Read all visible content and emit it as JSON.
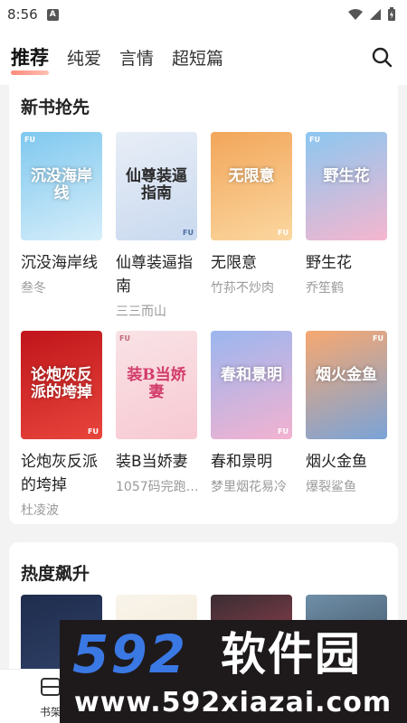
{
  "status_bar": {
    "time": "8:56",
    "notification_badge": "A"
  },
  "nav": {
    "tabs": [
      {
        "label": "推荐",
        "active": true
      },
      {
        "label": "纯爱",
        "active": false
      },
      {
        "label": "言情",
        "active": false
      },
      {
        "label": "超短篇",
        "active": false
      }
    ]
  },
  "sections": {
    "new_books": {
      "title": "新书抢先",
      "books": [
        {
          "title": "沉没海岸线",
          "author": "叁冬",
          "cover_text": "沉没海岸线",
          "cover_colors": [
            "#7fc8ef",
            "#d6eefa"
          ]
        },
        {
          "title": "仙尊装逼指南",
          "author": "三三而山",
          "cover_text": "仙尊装逼指南",
          "cover_colors": [
            "#e8eef7",
            "#c9d9ef"
          ]
        },
        {
          "title": "无限意",
          "author": "竹荪不炒肉",
          "cover_text": "无限意",
          "cover_colors": [
            "#f2a65a",
            "#fbd7a0"
          ]
        },
        {
          "title": "野生花",
          "author": "乔笙鹤",
          "cover_text": "野生花",
          "cover_colors": [
            "#8cc7f0",
            "#f5b6cf"
          ]
        },
        {
          "title": "论炮灰反派的垮掉",
          "author": "杜凌波",
          "cover_text": "论炮灰反派的垮掉",
          "cover_colors": [
            "#c0151b",
            "#e8453c"
          ]
        },
        {
          "title": "装B当娇妻",
          "author": "1057码完跑…",
          "cover_text": "装B当娇妻",
          "cover_colors": [
            "#f9e3e6",
            "#f7c9d2"
          ]
        },
        {
          "title": "春和景明",
          "author": "梦里烟花易冷",
          "cover_text": "春和景明",
          "cover_colors": [
            "#9bb6ef",
            "#f3b2d0"
          ]
        },
        {
          "title": "烟火金鱼",
          "author": "爆裂鲨鱼",
          "cover_text": "烟火金鱼",
          "cover_colors": [
            "#f7a870",
            "#7aa3d8"
          ]
        }
      ]
    },
    "hot": {
      "title": "热度飙升",
      "covers": [
        {
          "cover_text": "",
          "cover_colors": [
            "#1f2d4d",
            "#33466e"
          ]
        },
        {
          "cover_text": "",
          "cover_colors": [
            "#f9f4ea",
            "#efe6d4"
          ]
        },
        {
          "cover_text": "",
          "cover_colors": [
            "#3a2d33",
            "#c44a5c"
          ]
        },
        {
          "cover_text": "",
          "cover_colors": [
            "#6f8fa8",
            "#2d3b4a"
          ]
        }
      ]
    }
  },
  "bottom_nav": {
    "shelf_label": "书架"
  },
  "watermark": {
    "logo": "592",
    "cn": "软件园",
    "url": "www.592xiazai.com"
  },
  "colors": {
    "tab_underline": "#ff8a7a",
    "watermark_blue": "#3a78e4",
    "watermark_bg": "#1e1a1c"
  }
}
